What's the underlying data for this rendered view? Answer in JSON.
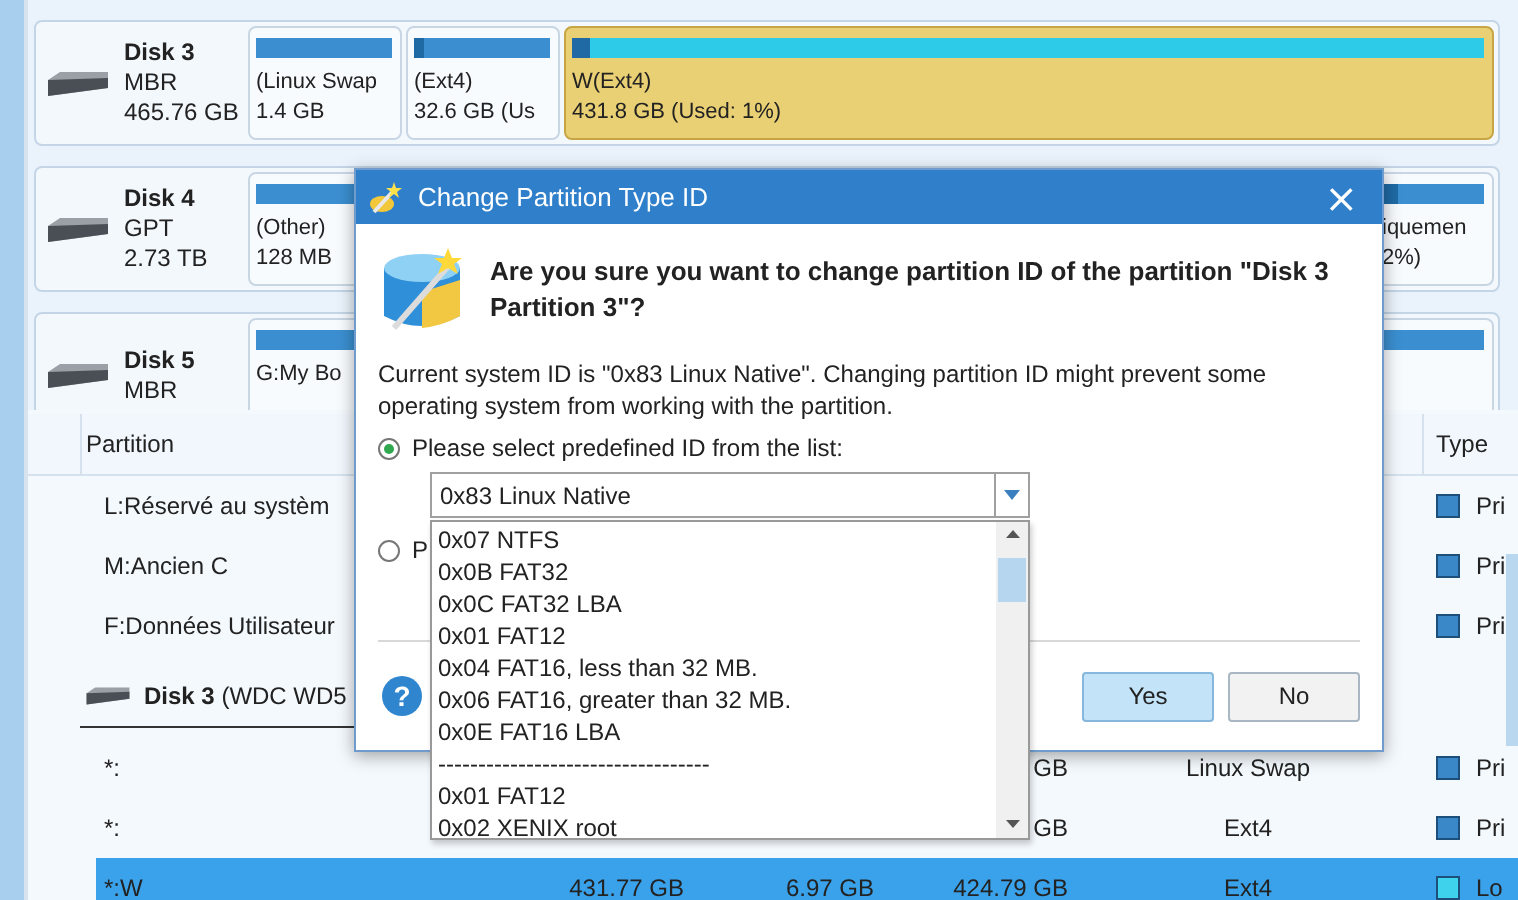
{
  "disks": [
    {
      "name": "Disk 3",
      "scheme": "MBR",
      "size": "465.76 GB",
      "partitions": [
        {
          "label": "(Linux Swap",
          "size": "1.4 GB",
          "color": "#3b8fd0",
          "selected": false
        },
        {
          "label": "(Ext4)",
          "size": "32.6 GB (Us",
          "color": "#3b8fd0",
          "level": 0.08,
          "selected": false
        },
        {
          "label": "W(Ext4)",
          "size": "431.8 GB (Used: 1%)",
          "color": "#2ecbe8",
          "level": 0.02,
          "selected": true
        }
      ]
    },
    {
      "name": "Disk 4",
      "scheme": "GPT",
      "size": "2.73 TB",
      "partitions": [
        {
          "label": "(Other)",
          "size": "128 MB",
          "color": "#3b8fd0",
          "selected": false
        },
        {
          "label": "iquemen",
          "size": "2%)",
          "color": "#3b8fd0",
          "level": 0.15,
          "selected": false
        }
      ]
    },
    {
      "name": "Disk 5",
      "scheme": "MBR",
      "partitions": [
        {
          "label": "G:My Bo",
          "color": "#3b8fd0",
          "selected": false
        },
        {
          "color": "#3b8fd0",
          "selected": false
        }
      ]
    }
  ],
  "table": {
    "columns": [
      "Partition",
      "Type"
    ],
    "rows": [
      {
        "kind": "partition",
        "partition": "L:Réservé au systèm",
        "type": "Pri",
        "color": "#3a88c8",
        "selected": false
      },
      {
        "kind": "partition",
        "partition": "M:Ancien C",
        "type": "Pri",
        "color": "#3a88c8",
        "selected": false
      },
      {
        "kind": "partition",
        "partition": "F:Données Utilisateur",
        "type": "Pri",
        "color": "#3a88c8",
        "selected": false
      },
      {
        "kind": "disk",
        "name": "Disk 3",
        "detail": " (WDC WD5"
      },
      {
        "kind": "partition",
        "partition": "*:",
        "unused": "GB",
        "file_system": "Linux Swap",
        "type": "Pri",
        "color": "#3a88c8",
        "selected": false
      },
      {
        "kind": "partition",
        "partition": "*:",
        "unused": "GB",
        "file_system": "Ext4",
        "type": "Pri",
        "color": "#3a88c8",
        "selected": false
      },
      {
        "kind": "partition",
        "partition": "*:W",
        "capacity": "431.77 GB",
        "used": "6.97 GB",
        "unused": "424.79 GB",
        "file_system": "Ext4",
        "type": "Lo",
        "color": "#3fd2ec",
        "selected": true
      }
    ]
  },
  "dialog": {
    "title": "Change Partition Type ID",
    "close": "×",
    "heading": "Are you sure you want to change partition ID of the partition \"Disk 3 Partition 3\"?",
    "message": "Current system ID is \"0x83 Linux Native\". Changing partition ID might prevent some operating system from working with the partition.",
    "options": [
      {
        "label": "Please select predefined ID from the list:",
        "selected": true
      },
      {
        "label": "P",
        "selected": false
      }
    ],
    "combo": {
      "value": "0x83 Linux Native"
    },
    "list": [
      "0x07 NTFS",
      "0x0B FAT32",
      "0x0C FAT32 LBA",
      "0x01 FAT12",
      "0x04 FAT16, less than 32 MB.",
      "0x06 FAT16, greater than 32 MB.",
      "0x0E FAT16 LBA",
      "----------------------------------",
      "0x01 FAT12",
      "0x02 XENIX root"
    ],
    "help": "?",
    "buttons": [
      {
        "label": "Yes",
        "selected": true
      },
      {
        "label": "No",
        "selected": false
      }
    ]
  }
}
